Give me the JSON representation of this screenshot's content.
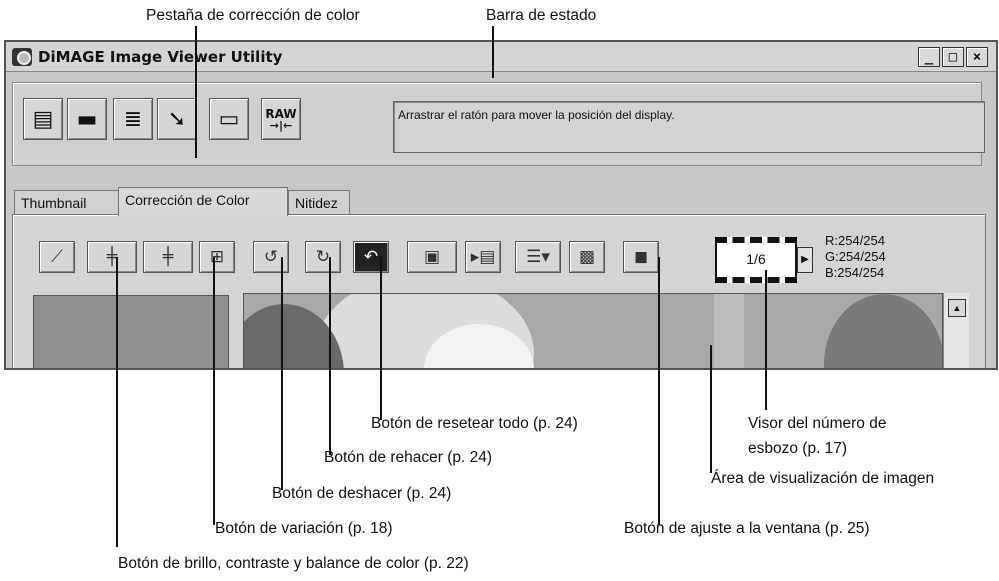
{
  "callouts": {
    "color_tab": "Pestaña de corrección de color",
    "status_bar": "Barra de estado",
    "reset_all": "Botón de resetear todo (p. 24)",
    "redo": "Botón de rehacer (p. 24)",
    "undo": "Botón de deshacer (p. 24)",
    "variation": "Botón de variación (p. 18)",
    "brightness": "Botón de brillo, contraste y balance de color (p. 22)",
    "frame_viewer": "Visor del número de esbozo (p. 17)",
    "image_area": "Área de visualización de imagen",
    "fit_window": "Botón de ajuste a la ventana (p. 25)"
  },
  "window": {
    "title": "DiMAGE Image Viewer Utility",
    "minimize": "_",
    "maximize": "□",
    "close": "×"
  },
  "toolbar": {
    "raw_label": "RAW",
    "raw_arrow": "→|←",
    "status_text": "Arrastrar el ratón para mover la posición del display."
  },
  "tabs": [
    "Thumbnail",
    "Corrección de Color",
    "Nitidez"
  ],
  "viewer": {
    "frame": "1/6",
    "r": "R:254/254",
    "g": "G:254/254",
    "b": "B:254/254"
  }
}
